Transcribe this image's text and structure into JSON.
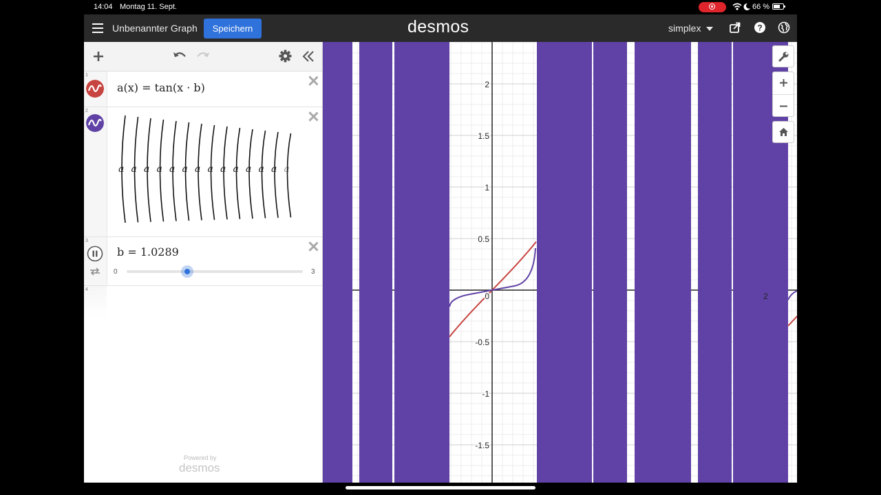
{
  "status_bar": {
    "time": "14:04",
    "date": "Montag 11. Sept.",
    "battery": "66 %",
    "icons": [
      "wifi-icon",
      "moon-icon",
      "battery-icon"
    ],
    "recording_color": "#e0242b"
  },
  "header": {
    "title": "Unbenannter Graph",
    "save_label": "Speichern",
    "logo": "desmos",
    "user": "simplex",
    "save_color": "#2f72dc"
  },
  "expressions": [
    {
      "index": "1",
      "color": "#c74440",
      "latex": "a(x) = tan(x · b)"
    },
    {
      "index": "2",
      "color": "#6042a6",
      "list_symbol": "a",
      "list_count": 14
    },
    {
      "index": "3",
      "latex": "b = 1.0289",
      "slider": {
        "min": "0",
        "max": "3",
        "value": 1.0289
      }
    },
    {
      "index": "4"
    }
  ],
  "footer": {
    "powered_by": "Powered by",
    "logo": "desmos"
  },
  "graph": {
    "y_ticks": [
      "2",
      "1.5",
      "1",
      "0.5",
      "0",
      "-0.5",
      "-1",
      "-1.5"
    ],
    "x_tick_partial": "2",
    "series": [
      {
        "name": "a(x)",
        "color": "#c74440"
      },
      {
        "name": "",
        "color": "#6042a6"
      }
    ]
  }
}
